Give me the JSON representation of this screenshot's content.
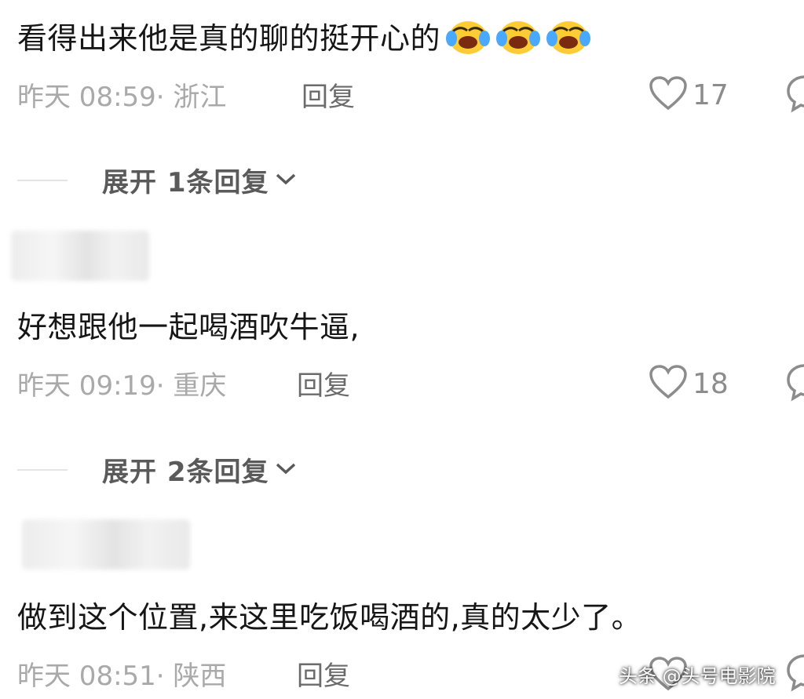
{
  "comments": [
    {
      "text": "看得出来他是真的聊的挺开心的",
      "emoji": "laughing-crying-emoji",
      "emoji_count": 3,
      "time": "昨天 08:59",
      "location": "· 浙江",
      "reply_label": "回复",
      "likes": "17",
      "expand_label": "展开 1条回复"
    },
    {
      "text": "好想跟他一起喝酒吹牛逼,",
      "time": "昨天 09:19",
      "location": "· 重庆",
      "reply_label": "回复",
      "likes": "18",
      "expand_label": "展开 2条回复"
    },
    {
      "text": "做到这个位置,来这里吃饭喝酒的,真的太少了。",
      "time": "昨天 08:51",
      "location": "· 陕西",
      "reply_label": "回复"
    }
  ],
  "watermark": "头条 @头号电影院",
  "colors": {
    "text": "#161616",
    "meta": "#a9a9a9",
    "reply": "#6b6b6b",
    "icon": "#8c8c8c"
  },
  "icons": [
    "heart-icon",
    "chevron-down-icon",
    "comment-icon"
  ]
}
